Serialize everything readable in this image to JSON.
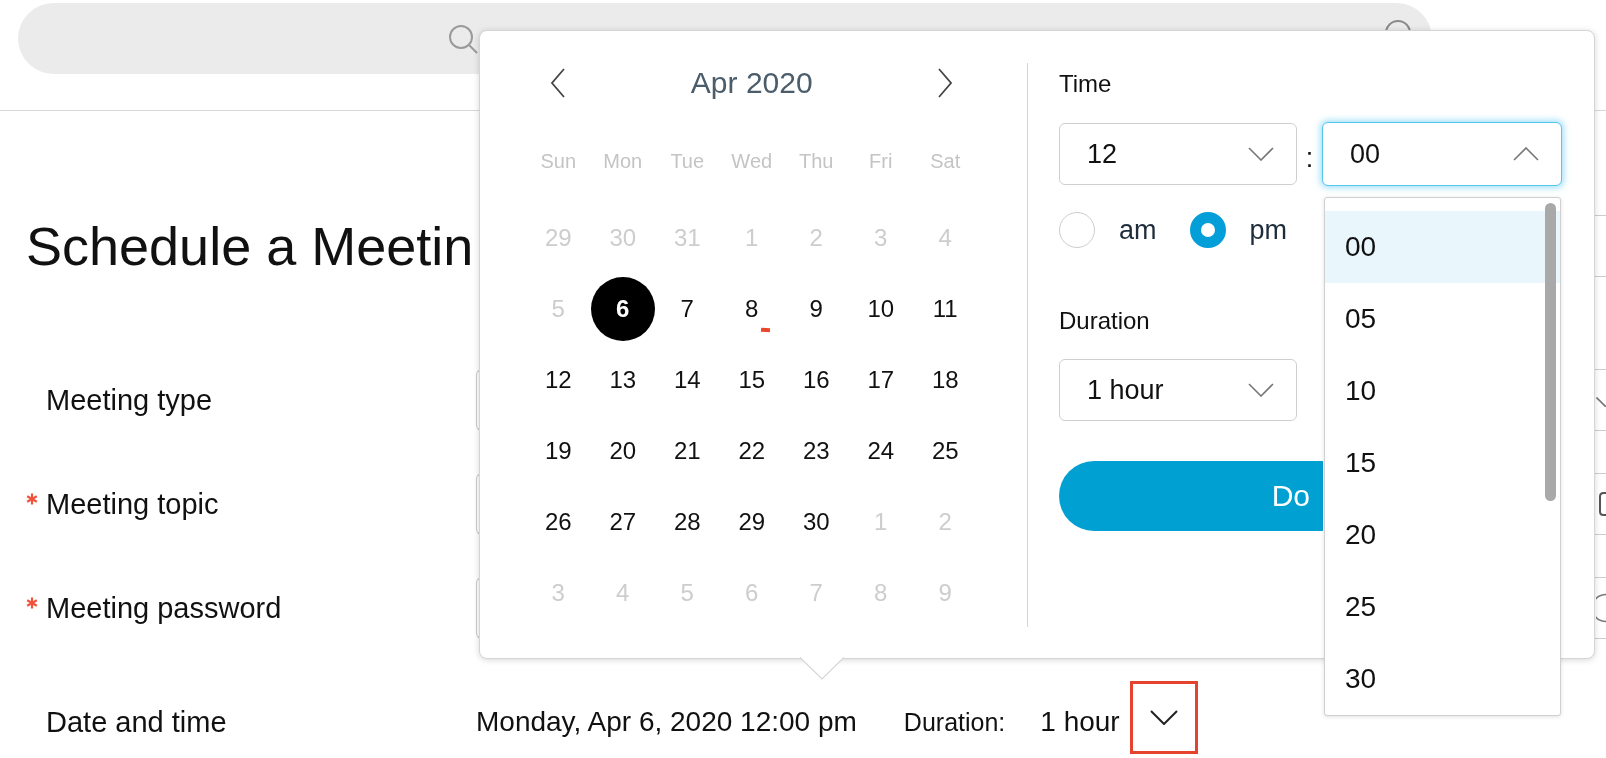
{
  "page_title": "Schedule a Meetin",
  "form": {
    "rows": [
      {
        "label": "Meeting type",
        "required": false,
        "kind": "select"
      },
      {
        "label": "Meeting topic",
        "required": true,
        "kind": "text"
      },
      {
        "label": "Meeting password",
        "required": true,
        "kind": "password"
      },
      {
        "label": "Date and time",
        "required": false,
        "kind": "datetime",
        "value": "Monday, Apr 6, 2020 12:00 pm",
        "duration_label": "Duration:",
        "duration_value": "1 hour",
        "toggle_highlighted": true
      }
    ]
  },
  "date_picker": {
    "month_title": "Apr 2020",
    "weekdays": [
      "Sun",
      "Mon",
      "Tue",
      "Wed",
      "Thu",
      "Fri",
      "Sat"
    ],
    "weeks": [
      [
        {
          "label": "29",
          "disabled": true,
          "selected": false,
          "today": false
        },
        {
          "label": "30",
          "disabled": true,
          "selected": false,
          "today": false
        },
        {
          "label": "31",
          "disabled": true,
          "selected": false,
          "today": false
        },
        {
          "label": "1",
          "disabled": true,
          "selected": false,
          "today": false
        },
        {
          "label": "2",
          "disabled": true,
          "selected": false,
          "today": false
        },
        {
          "label": "3",
          "disabled": true,
          "selected": false,
          "today": false
        },
        {
          "label": "4",
          "disabled": true,
          "selected": false,
          "today": false
        }
      ],
      [
        {
          "label": "5",
          "disabled": true,
          "selected": false,
          "today": false
        },
        {
          "label": "6",
          "disabled": false,
          "selected": true,
          "today": false
        },
        {
          "label": "7",
          "disabled": false,
          "selected": false,
          "today": false
        },
        {
          "label": "8",
          "disabled": false,
          "selected": false,
          "today": true
        },
        {
          "label": "9",
          "disabled": false,
          "selected": false,
          "today": false
        },
        {
          "label": "10",
          "disabled": false,
          "selected": false,
          "today": false
        },
        {
          "label": "11",
          "disabled": false,
          "selected": false,
          "today": false
        }
      ],
      [
        {
          "label": "12",
          "disabled": false,
          "selected": false,
          "today": false
        },
        {
          "label": "13",
          "disabled": false,
          "selected": false,
          "today": false
        },
        {
          "label": "14",
          "disabled": false,
          "selected": false,
          "today": false
        },
        {
          "label": "15",
          "disabled": false,
          "selected": false,
          "today": false
        },
        {
          "label": "16",
          "disabled": false,
          "selected": false,
          "today": false
        },
        {
          "label": "17",
          "disabled": false,
          "selected": false,
          "today": false
        },
        {
          "label": "18",
          "disabled": false,
          "selected": false,
          "today": false
        }
      ],
      [
        {
          "label": "19",
          "disabled": false,
          "selected": false,
          "today": false
        },
        {
          "label": "20",
          "disabled": false,
          "selected": false,
          "today": false
        },
        {
          "label": "21",
          "disabled": false,
          "selected": false,
          "today": false
        },
        {
          "label": "22",
          "disabled": false,
          "selected": false,
          "today": false
        },
        {
          "label": "23",
          "disabled": false,
          "selected": false,
          "today": false
        },
        {
          "label": "24",
          "disabled": false,
          "selected": false,
          "today": false
        },
        {
          "label": "25",
          "disabled": false,
          "selected": false,
          "today": false
        }
      ],
      [
        {
          "label": "26",
          "disabled": false,
          "selected": false,
          "today": false
        },
        {
          "label": "27",
          "disabled": false,
          "selected": false,
          "today": false
        },
        {
          "label": "28",
          "disabled": false,
          "selected": false,
          "today": false
        },
        {
          "label": "29",
          "disabled": false,
          "selected": false,
          "today": false
        },
        {
          "label": "30",
          "disabled": false,
          "selected": false,
          "today": false
        },
        {
          "label": "1",
          "disabled": true,
          "selected": false,
          "today": false
        },
        {
          "label": "2",
          "disabled": true,
          "selected": false,
          "today": false
        }
      ],
      [
        {
          "label": "3",
          "disabled": true,
          "selected": false,
          "today": false
        },
        {
          "label": "4",
          "disabled": true,
          "selected": false,
          "today": false
        },
        {
          "label": "5",
          "disabled": true,
          "selected": false,
          "today": false
        },
        {
          "label": "6",
          "disabled": true,
          "selected": false,
          "today": false
        },
        {
          "label": "7",
          "disabled": true,
          "selected": false,
          "today": false
        },
        {
          "label": "8",
          "disabled": true,
          "selected": false,
          "today": false
        },
        {
          "label": "9",
          "disabled": true,
          "selected": false,
          "today": false
        }
      ]
    ],
    "time": {
      "label": "Time",
      "hour": {
        "value": "12",
        "open": false
      },
      "separator": ":",
      "minute": {
        "value": "00",
        "open": true
      },
      "meridiem": [
        {
          "label": "am",
          "selected": false
        },
        {
          "label": "pm",
          "selected": true
        }
      ]
    },
    "duration": {
      "label": "Duration",
      "value": "1 hour",
      "open": false
    },
    "done_button": {
      "label": "Do"
    },
    "minute_options": [
      {
        "label": "00",
        "selected": true
      },
      {
        "label": "05",
        "selected": false
      },
      {
        "label": "10",
        "selected": false
      },
      {
        "label": "15",
        "selected": false
      },
      {
        "label": "20",
        "selected": false
      },
      {
        "label": "25",
        "selected": false
      },
      {
        "label": "30",
        "selected": false
      }
    ]
  }
}
